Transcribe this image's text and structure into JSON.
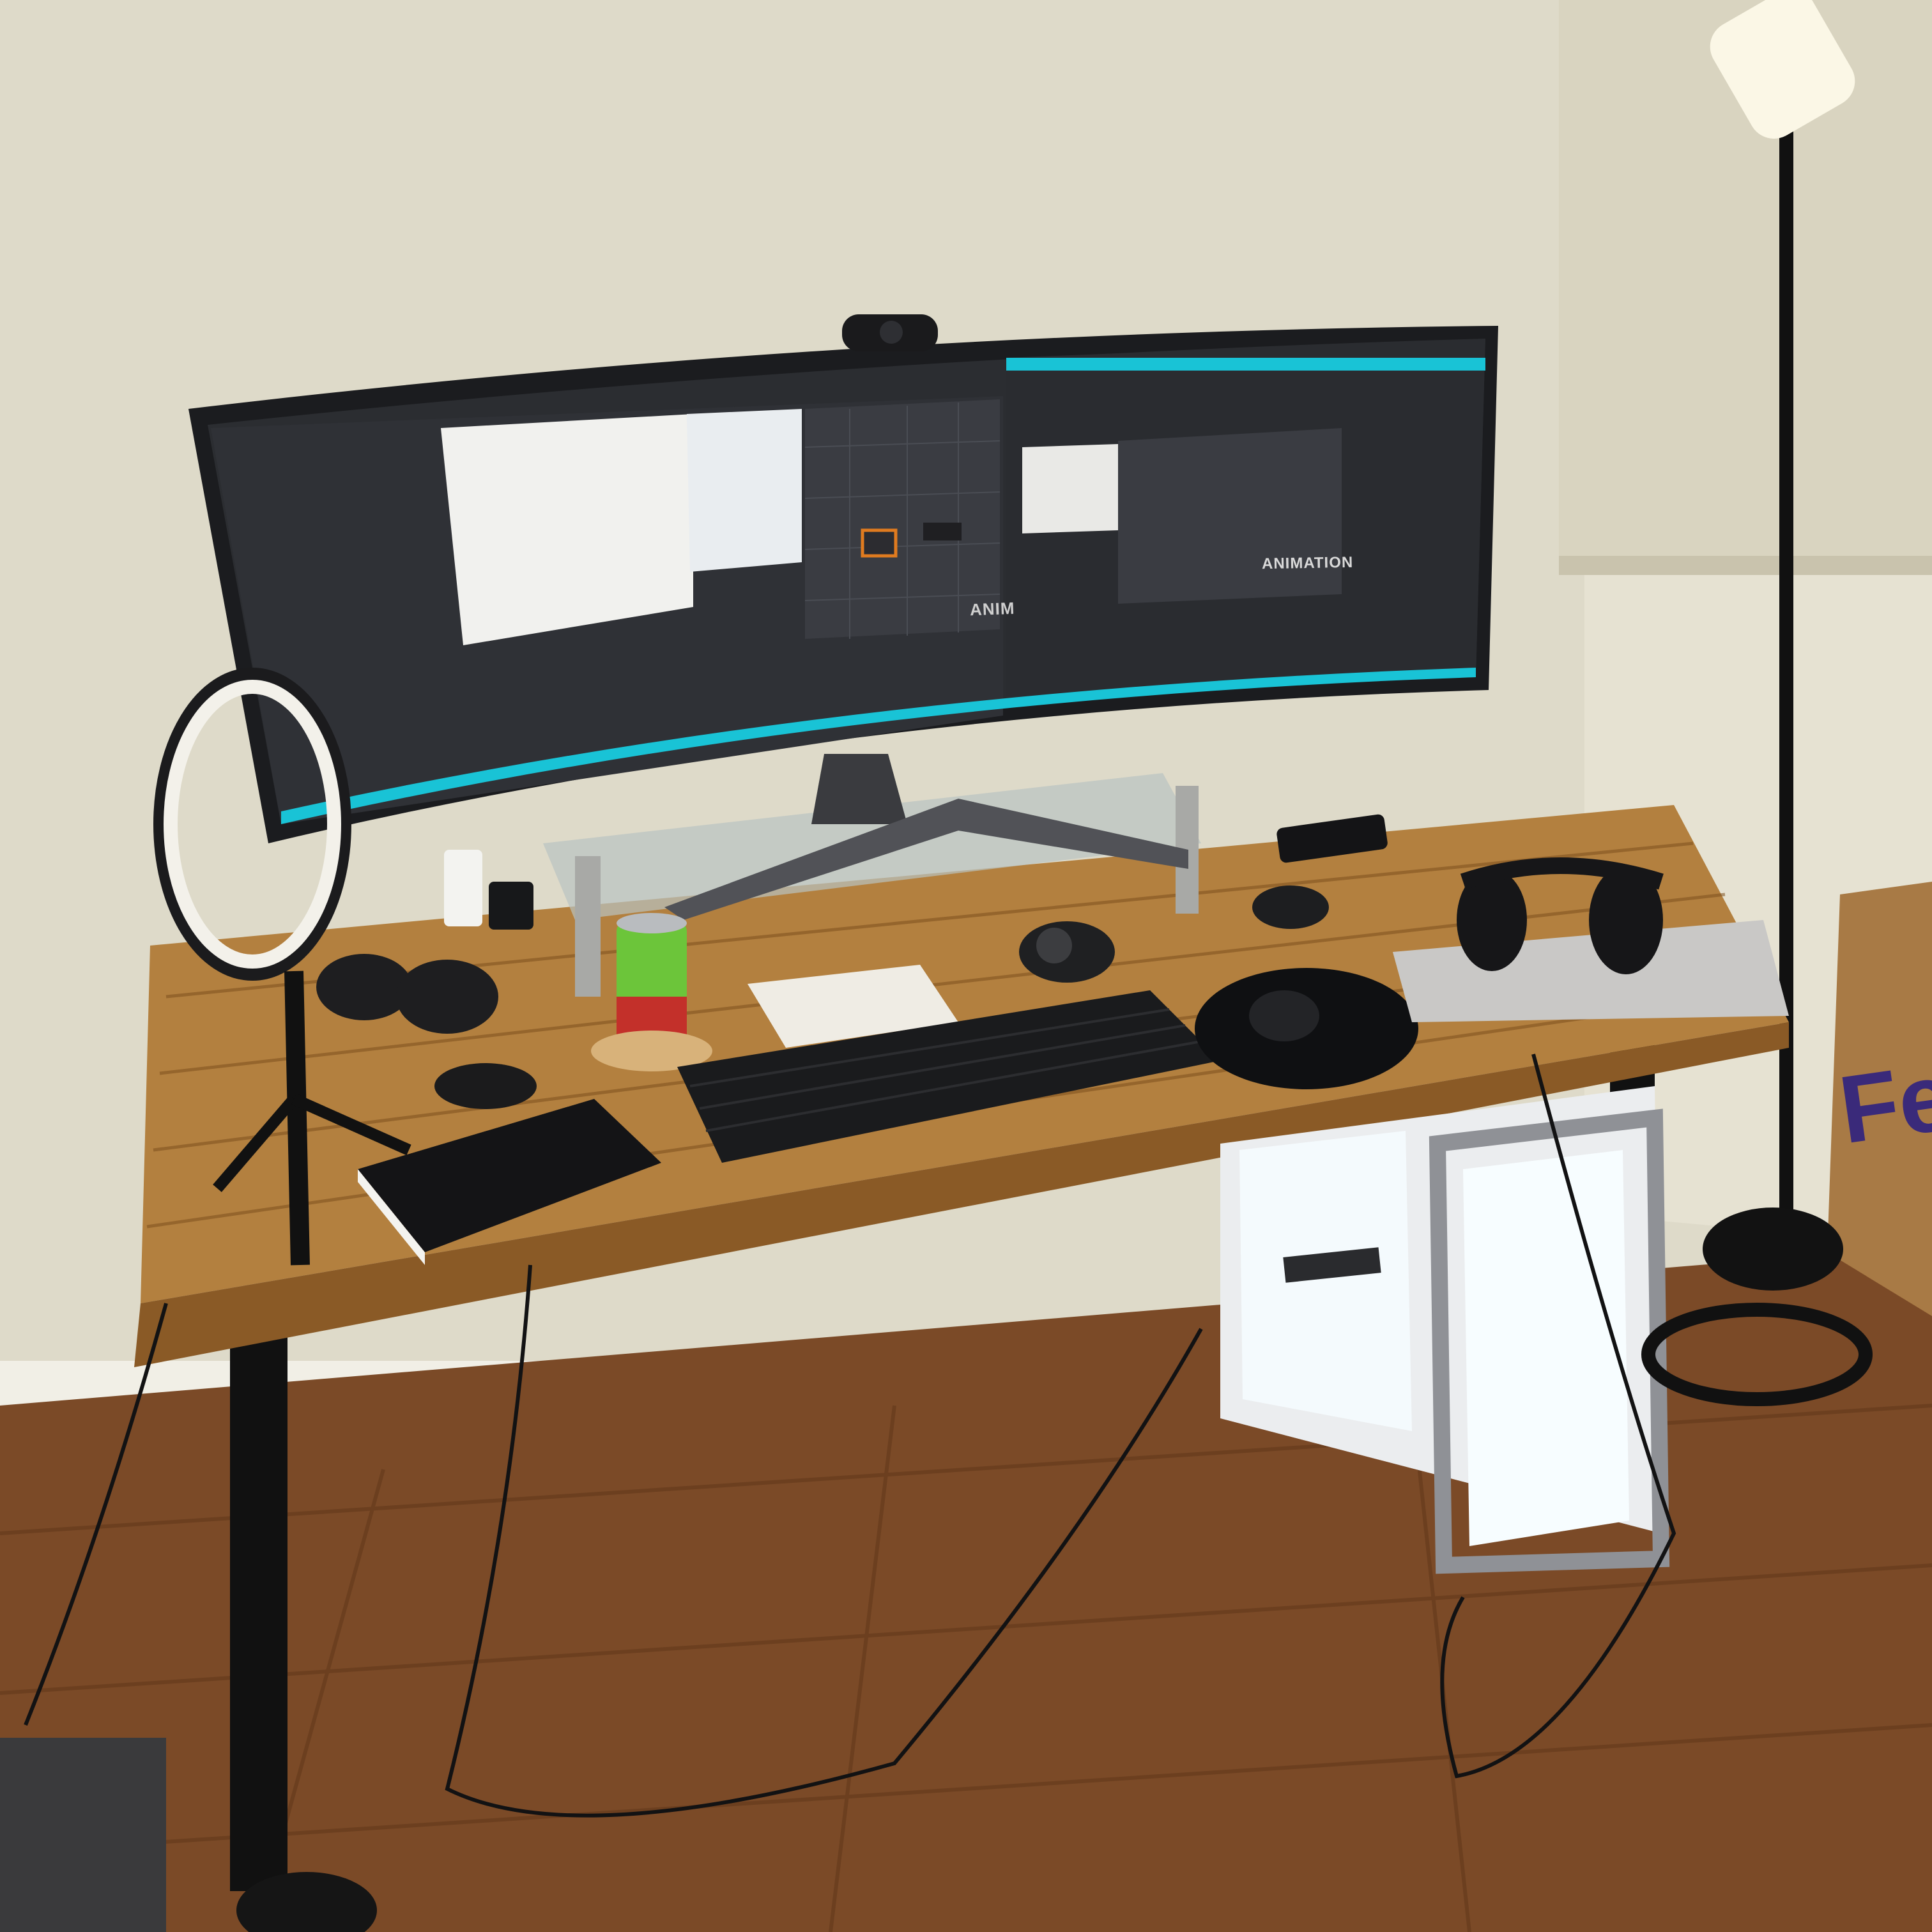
{
  "scene": {
    "description_free": true,
    "colors": {
      "wall": "#dcd8c6",
      "floor": "#7a4a28",
      "desk": "#b07a3c",
      "screen_dark": "#2b2d31",
      "screen_accent": "#19c3d6"
    }
  },
  "monitor": {
    "left_screen_label": "ANIM",
    "right_screen_label": "ANIMATION"
  },
  "box": {
    "brand_fragment": "Fe"
  }
}
